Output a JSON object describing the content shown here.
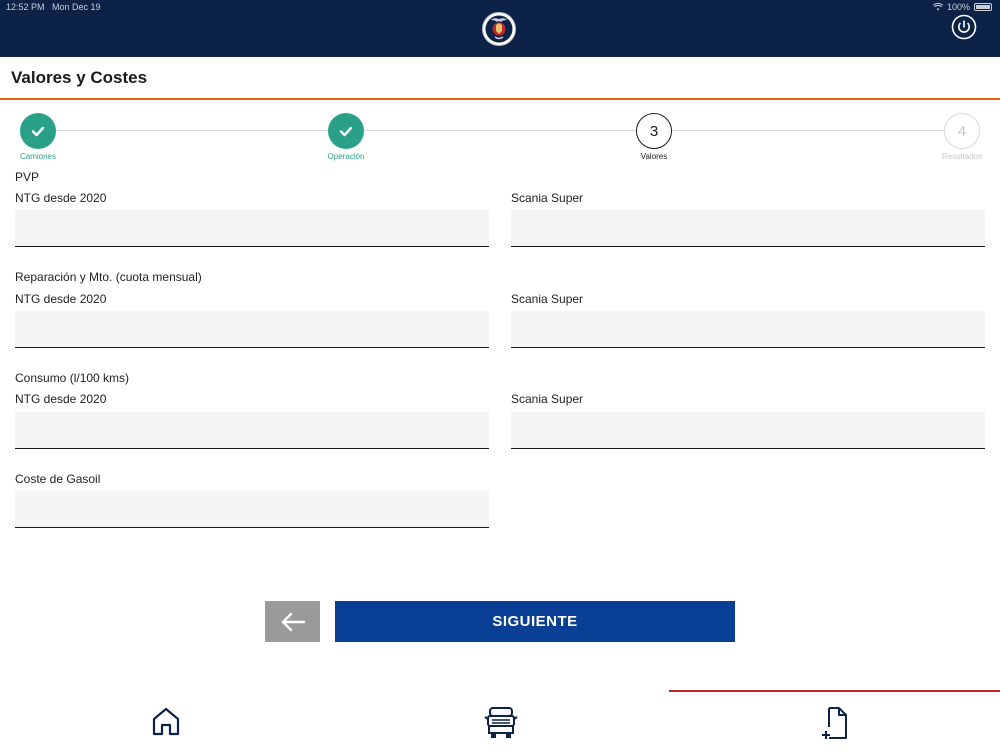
{
  "status_bar": {
    "time": "12:52 PM",
    "date": "Mon Dec 19",
    "battery": "100%"
  },
  "header": {
    "logo_icon": "scania-griffin-logo-icon",
    "power_icon": "power-icon"
  },
  "page": {
    "title": "Valores y Costes",
    "accent_color": "#e8611c"
  },
  "stepper": {
    "steps": [
      {
        "number": "1",
        "label": "Camiones",
        "state": "done"
      },
      {
        "number": "2",
        "label": "Operación",
        "state": "done"
      },
      {
        "number": "3",
        "label": "Valores",
        "state": "active"
      },
      {
        "number": "4",
        "label": "Resultados",
        "state": "todo"
      }
    ],
    "done_color": "#2aa089"
  },
  "form": {
    "pvp": {
      "section": "PVP",
      "left_label": "NTG desde 2020",
      "right_label": "Scania Super",
      "left_value": "",
      "right_value": ""
    },
    "reparacion": {
      "section": "Reparación y Mto. (cuota mensual)",
      "left_label": "NTG desde 2020",
      "right_label": "Scania Super",
      "left_value": "",
      "right_value": ""
    },
    "consumo": {
      "section": "Consumo (l/100 kms)",
      "left_label": "NTG desde 2020",
      "right_label": "Scania Super",
      "left_value": "",
      "right_value": ""
    },
    "gasoil": {
      "section": "Coste de Gasoil",
      "value": ""
    }
  },
  "actions": {
    "back_icon": "arrow-left-icon",
    "next_label": "SIGUIENTE",
    "next_color": "#0a3f96"
  },
  "tabbar": {
    "tabs": [
      {
        "icon": "home-icon",
        "selected": false
      },
      {
        "icon": "truck-front-icon",
        "selected": false
      },
      {
        "icon": "new-document-icon",
        "selected": true
      }
    ],
    "indicator_color": "#c0262d"
  }
}
